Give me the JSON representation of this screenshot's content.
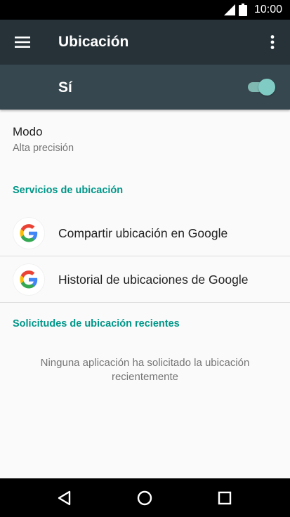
{
  "status_bar": {
    "time": "10:00",
    "icons": [
      "signal-icon",
      "battery-icon"
    ]
  },
  "app_bar": {
    "title": "Ubicación",
    "icons": [
      "menu-icon",
      "more-vert-icon"
    ]
  },
  "master_switch": {
    "label": "Sí",
    "state": "on",
    "accent_color": "#80cbc4"
  },
  "mode": {
    "title": "Modo",
    "value": "Alta precisión"
  },
  "location_services": {
    "header": "Servicios de ubicación",
    "items": [
      {
        "label": "Compartir ubicación en Google",
        "icon": "google-icon"
      },
      {
        "label": "Historial de ubicaciones de Google",
        "icon": "google-icon"
      }
    ]
  },
  "recent_requests": {
    "header": "Solicitudes de ubicación recientes",
    "empty_message": "Ninguna aplicación ha solicitado la ubicación recientemente"
  },
  "navigation_bar": {
    "buttons": [
      "back-icon",
      "home-icon",
      "recents-icon"
    ]
  },
  "colors": {
    "app_bar": "#263238",
    "switch_bar": "#37474f",
    "section_header": "#009688",
    "background": "#fafafa"
  }
}
